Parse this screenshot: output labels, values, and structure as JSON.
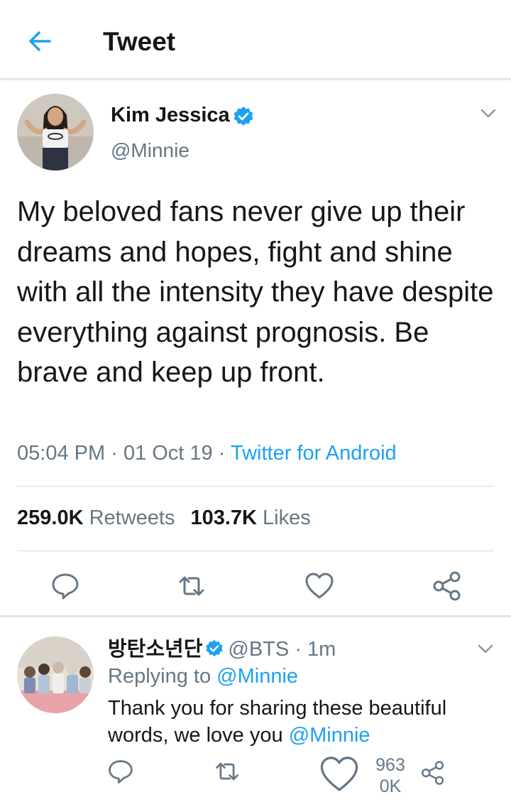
{
  "header": {
    "title": "Tweet"
  },
  "tweet": {
    "author_name": "Kim Jessica",
    "author_handle": "@Minnie",
    "text": "My beloved fans never give up their dreams and hopes, fight and shine with all the intensity they have despite everything against prognosis. Be brave and keep up front.",
    "time": "05:04 PM",
    "separator": "·",
    "date": "01 Oct 19",
    "source": "Twitter for Android",
    "retweets_count": "259.0K",
    "retweets_label": "Retweets",
    "likes_count": "103.7K",
    "likes_label": "Likes",
    "actions": [
      "reply-icon",
      "retweet-icon",
      "like-icon",
      "share-icon"
    ]
  },
  "reply": {
    "author_name": "방탄소년단",
    "author_handle": "@BTS",
    "separator": "·",
    "time_ago": "1m",
    "replying_label": "Replying to",
    "replying_handle": "@Minnie",
    "text": "Thank you for sharing these beautiful words, we love you",
    "mention": "@Minnie",
    "likes_count_line1": "963",
    "likes_count_line2": "0K"
  },
  "colors": {
    "accent": "#1da1f2",
    "text_primary": "#14171a",
    "text_secondary": "#657786",
    "divider": "#e1e8ed"
  }
}
